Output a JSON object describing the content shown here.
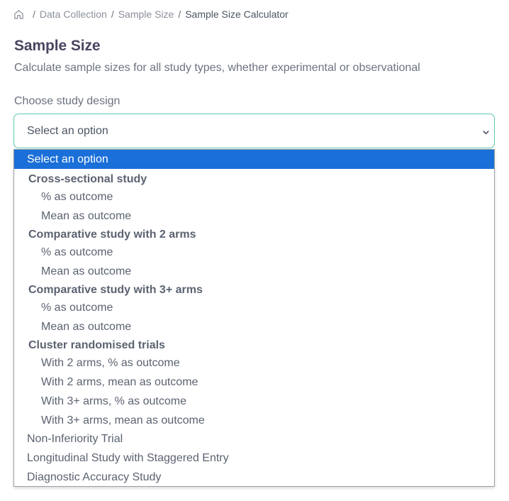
{
  "breadcrumb": {
    "home_icon": "home-icon",
    "items": [
      "Data Collection",
      "Sample Size"
    ],
    "current": "Sample Size Calculator",
    "separator": "/"
  },
  "page": {
    "title": "Sample Size",
    "subtitle": "Calculate sample sizes for all study types, whether experimental or observational"
  },
  "study_design": {
    "label": "Choose study design",
    "selected_value": "Select an option",
    "accent_color": "#5fc7b0",
    "highlight_color": "#1a6fd8",
    "options": [
      {
        "text": "Select an option",
        "kind": "option",
        "selected": true
      },
      {
        "text": "Cross-sectional study",
        "kind": "group"
      },
      {
        "text": "% as outcome",
        "kind": "sub"
      },
      {
        "text": "Mean as outcome",
        "kind": "sub"
      },
      {
        "text": "Comparative study with 2 arms",
        "kind": "group"
      },
      {
        "text": "% as outcome",
        "kind": "sub"
      },
      {
        "text": "Mean as outcome",
        "kind": "sub"
      },
      {
        "text": "Comparative study with 3+ arms",
        "kind": "group"
      },
      {
        "text": "% as outcome",
        "kind": "sub"
      },
      {
        "text": "Mean as outcome",
        "kind": "sub"
      },
      {
        "text": "Cluster randomised trials",
        "kind": "group"
      },
      {
        "text": "With 2 arms, % as outcome",
        "kind": "sub"
      },
      {
        "text": "With 2 arms, mean as outcome",
        "kind": "sub"
      },
      {
        "text": "With 3+ arms, % as outcome",
        "kind": "sub"
      },
      {
        "text": "With 3+ arms, mean as outcome",
        "kind": "sub"
      },
      {
        "text": "Non-Inferiority Trial",
        "kind": "option"
      },
      {
        "text": "Longitudinal Study with Staggered Entry",
        "kind": "option"
      },
      {
        "text": "Diagnostic Accuracy Study",
        "kind": "option"
      }
    ]
  }
}
